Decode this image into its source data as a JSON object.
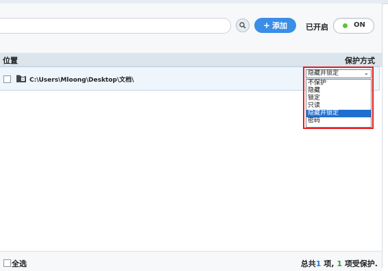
{
  "toolbar": {
    "search": {
      "value": "",
      "icon": "search-icon"
    },
    "add_button": {
      "icon": "plus-icon",
      "label": "添加"
    },
    "enabled_label": "已开启",
    "toggle": {
      "label": "ON",
      "state": "on",
      "dot_color": "#5cc33a"
    }
  },
  "columns": {
    "location": "位置",
    "protection": "保护方式"
  },
  "rows": [
    {
      "checked": false,
      "icon": "folder-lock-icon",
      "path": "C:\\Users\\Mloong\\Desktop\\文档\\",
      "protection": "隐藏并锁定"
    }
  ],
  "protection_dropdown": {
    "selected": "隐藏并锁定",
    "options": [
      "不保护",
      "隐藏",
      "锁定",
      "只读",
      "隐藏并锁定",
      "密码"
    ],
    "highlighted_index": 4
  },
  "footer": {
    "select_all_label": "全选",
    "summary_prefix": "总共",
    "total_count": "1",
    "summary_mid": "项,",
    "protected_count": "1",
    "summary_suffix": "项受保护."
  },
  "colors": {
    "accent": "#3a8ee6",
    "highlight_border": "#e02020",
    "selected_option": "#1e6fd0"
  }
}
